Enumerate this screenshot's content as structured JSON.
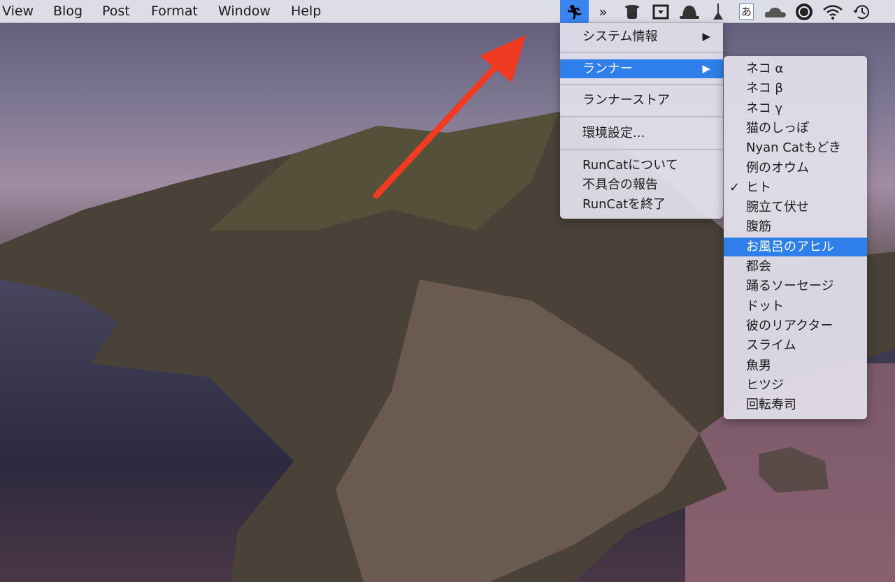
{
  "menubar": {
    "items": [
      "View",
      "Blog",
      "Post",
      "Format",
      "Window",
      "Help"
    ]
  },
  "status_icons": [
    "runner-icon",
    "chevron-arrows-icon",
    "top-hat-icon",
    "download-box-icon",
    "bowler-hat-icon",
    "broom-icon",
    "input-method-icon",
    "cloud-icon",
    "sync-icon",
    "wifi-icon",
    "time-machine-icon"
  ],
  "input_method_label": "あ",
  "main_menu": {
    "items": [
      "システム情報",
      "ランナー",
      "ランナーストア",
      "環境設定...",
      "RunCatについて",
      "不具合の報告",
      "RunCatを終了"
    ],
    "submenu_arrow": "▶"
  },
  "runner_submenu": {
    "items": [
      "ネコ α",
      "ネコ β",
      "ネコ γ",
      "猫のしっぽ",
      "Nyan Catもどき",
      "例のオウム",
      "ヒト",
      "腕立て伏せ",
      "腹筋",
      "お風呂のアヒル",
      "都会",
      "踊るソーセージ",
      "ドット",
      "彼のリアクター",
      "スライム",
      "魚男",
      "ヒツジ",
      "回転寿司"
    ],
    "checked": "ヒト",
    "highlighted": "お風呂のアヒル",
    "check_mark": "✓"
  },
  "colors": {
    "highlight": "#2f7fea",
    "arrow": "#f03a22"
  }
}
